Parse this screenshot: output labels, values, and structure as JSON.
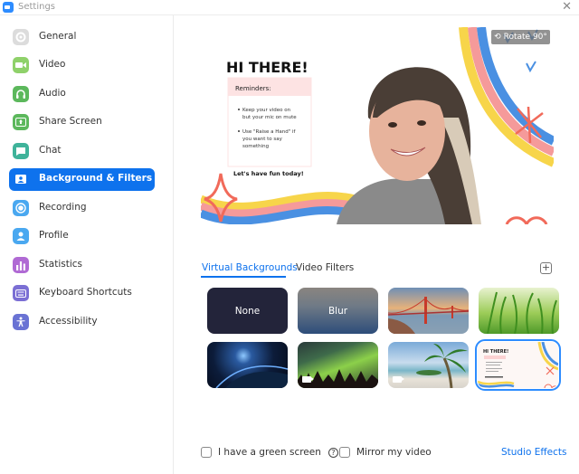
{
  "window": {
    "title": "Settings",
    "close_icon": "close-icon"
  },
  "sidebar": {
    "items": [
      {
        "label": "General",
        "icon": "gear-icon",
        "color": "#d9d9d9",
        "active": false
      },
      {
        "label": "Video",
        "icon": "video-icon",
        "color": "#8fd16a",
        "active": false
      },
      {
        "label": "Audio",
        "icon": "headphones-icon",
        "color": "#5cb85c",
        "active": false
      },
      {
        "label": "Share Screen",
        "icon": "share-screen-icon",
        "color": "#5cb85c",
        "active": false
      },
      {
        "label": "Chat",
        "icon": "chat-icon",
        "color": "#3fb39a",
        "active": false
      },
      {
        "label": "Background & Filters",
        "icon": "background-icon",
        "color": "#0e72ed",
        "active": true
      },
      {
        "label": "Recording",
        "icon": "record-icon",
        "color": "#4aa8f0",
        "active": false
      },
      {
        "label": "Profile",
        "icon": "profile-icon",
        "color": "#4aa8f0",
        "active": false
      },
      {
        "label": "Statistics",
        "icon": "statistics-icon",
        "color": "#b06ad4",
        "active": false
      },
      {
        "label": "Keyboard Shortcuts",
        "icon": "keyboard-icon",
        "color": "#7b6fd4",
        "active": false
      },
      {
        "label": "Accessibility",
        "icon": "accessibility-icon",
        "color": "#6a73d4",
        "active": false
      }
    ]
  },
  "preview": {
    "rotate_label": "Rotate 90°",
    "background_text": {
      "heading": "HI THERE!",
      "reminders_title": "Reminders:",
      "bullets": [
        "Keep your video on but your mic on mute",
        "Use \"Raise a Hand\" if you want to say something"
      ],
      "closing": "Let's have fun today!"
    }
  },
  "tabs": [
    {
      "label": "Virtual Backgrounds",
      "active": true
    },
    {
      "label": "Video Filters",
      "active": false
    }
  ],
  "add_button_label": "+",
  "backgrounds": [
    {
      "label": "None",
      "kind": "none",
      "selected": false,
      "video": false
    },
    {
      "label": "Blur",
      "kind": "blur",
      "selected": false,
      "video": false
    },
    {
      "label": "",
      "kind": "golden-gate-bridge",
      "selected": false,
      "video": false
    },
    {
      "label": "",
      "kind": "grass",
      "selected": false,
      "video": false
    },
    {
      "label": "",
      "kind": "earth-from-space",
      "selected": false,
      "video": false
    },
    {
      "label": "",
      "kind": "aurora",
      "selected": false,
      "video": true
    },
    {
      "label": "",
      "kind": "beach",
      "selected": false,
      "video": true
    },
    {
      "label": "",
      "kind": "hi-there-classroom",
      "selected": true,
      "video": false
    }
  ],
  "footer": {
    "green_screen_label": "I have a green screen",
    "green_screen_checked": false,
    "help_label": "?",
    "mirror_label": "Mirror my video",
    "mirror_checked": false,
    "studio_effects_label": "Studio Effects"
  }
}
